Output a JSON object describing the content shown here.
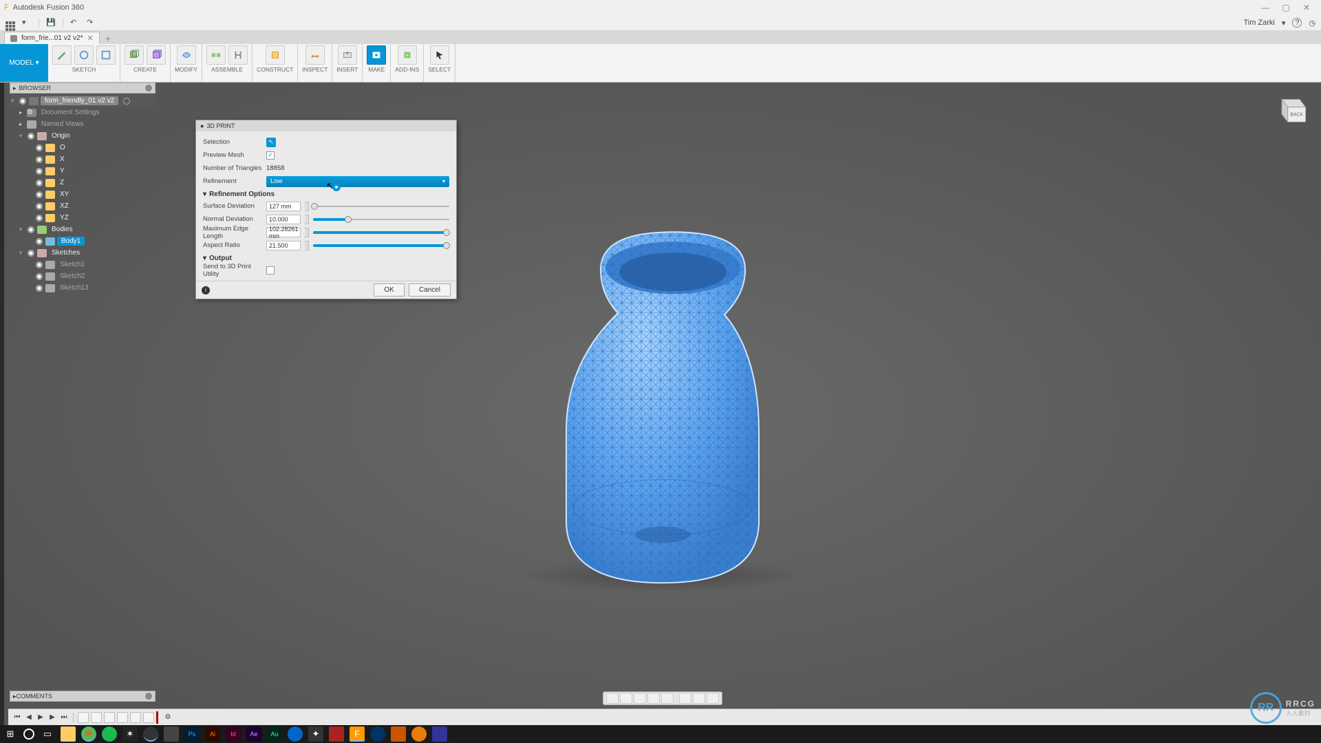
{
  "app": {
    "title": "Autodesk Fusion 360",
    "user": "Tim Zarki"
  },
  "tab": {
    "name": "form_frie...01 v2 v2*"
  },
  "ribbon": {
    "model": "MODEL",
    "groups": [
      "SKETCH",
      "CREATE",
      "MODIFY",
      "ASSEMBLE",
      "CONSTRUCT",
      "INSPECT",
      "INSERT",
      "MAKE",
      "ADD-INS",
      "SELECT"
    ]
  },
  "browser": {
    "title": "BROWSER",
    "root": "form_friendly_01 v2 v2",
    "items": [
      "Document Settings",
      "Named Views",
      "Origin",
      "O",
      "X",
      "Y",
      "Z",
      "XY",
      "XZ",
      "YZ",
      "Bodies",
      "Body1",
      "Sketches",
      "Sketch1",
      "Sketch2",
      "Sketch13"
    ]
  },
  "dialog": {
    "title": "3D PRINT",
    "selection_label": "Selection",
    "preview_label": "Preview Mesh",
    "triangles_label": "Number of Triangles",
    "triangles_value": "18858",
    "refinement_label": "Refinement",
    "refinement_value": "Low",
    "refopts_label": "Refinement Options",
    "surface_dev_label": "Surface Deviation",
    "surface_dev_value": "127 mm",
    "normal_dev_label": "Normal Deviation",
    "normal_dev_value": "10.000",
    "maxedge_label": "Maximum Edge Length",
    "maxedge_value": "102.28261 mm",
    "aspect_label": "Aspect Ratio",
    "aspect_value": "21.500",
    "output_label": "Output",
    "send_label": "Send to 3D Print Utility",
    "ok": "OK",
    "cancel": "Cancel"
  },
  "comments": "COMMENTS",
  "viewcube": "BACK",
  "watermark": {
    "brand": "RRCG",
    "sub": "人人素材"
  }
}
